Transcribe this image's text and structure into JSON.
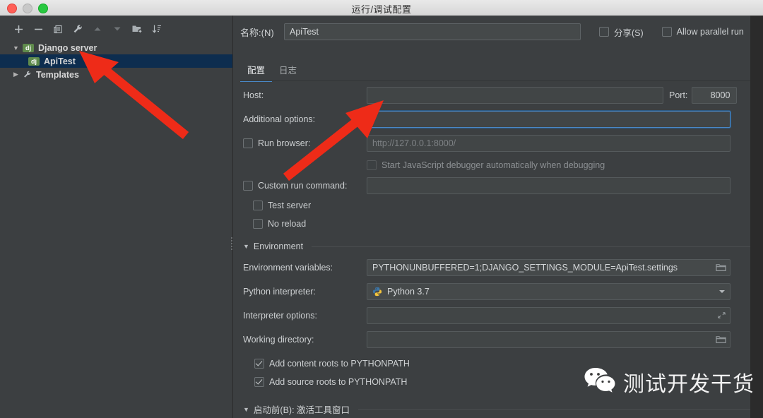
{
  "window": {
    "title": "运行/调试配置",
    "traffic_lights": [
      "close-red",
      "minimize-gray",
      "zoom-green"
    ]
  },
  "sidebar": {
    "toolbar": [
      {
        "name": "add-button",
        "glyph": "+"
      },
      {
        "name": "remove-button",
        "glyph": "−"
      },
      {
        "name": "copy-configuration-button",
        "glyph": "copy-icon"
      },
      {
        "name": "edit-templates-button",
        "glyph": "wrench-icon"
      },
      {
        "name": "move-up-button",
        "glyph": "triangle-up-icon"
      },
      {
        "name": "move-down-button",
        "glyph": "triangle-down-icon"
      },
      {
        "name": "new-folder-button",
        "glyph": "folder-plus-icon"
      },
      {
        "name": "sort-configurations-button",
        "glyph": "sort-icon"
      }
    ],
    "tree": [
      {
        "label": "Django server",
        "badge": "dj",
        "expanded": true,
        "type": "group",
        "selected": false
      },
      {
        "label": "ApiTest",
        "badge": "dj",
        "type": "item",
        "selected": true
      },
      {
        "label": "Templates",
        "badge": "",
        "expanded": false,
        "type": "templates",
        "selected": false
      }
    ]
  },
  "main": {
    "name_label": "名称:(N)",
    "name_value": "ApiTest",
    "share_checkbox": {
      "label": "分享(S)",
      "checked": false
    },
    "parallel_checkbox": {
      "label": "Allow parallel run",
      "checked": false
    },
    "tabs": [
      {
        "label": "配置",
        "active": true
      },
      {
        "label": "日志",
        "active": false
      }
    ],
    "fields": {
      "host": {
        "label": "Host:",
        "value": "",
        "placeholder": ""
      },
      "port": {
        "label": "Port:",
        "value": "8000"
      },
      "additional_options": {
        "label": "Additional options:",
        "value": "",
        "focused": true
      },
      "run_browser": {
        "label": "Run browser:",
        "checked": false,
        "value": "",
        "placeholder": "http://127.0.0.1:8000/"
      },
      "start_js_debugger": {
        "label": "Start JavaScript debugger automatically when debugging",
        "checked": false,
        "disabled": true
      },
      "custom_run_command": {
        "label": "Custom run command:",
        "checked": false,
        "value": ""
      },
      "test_server": {
        "label": "Test server",
        "checked": false
      },
      "no_reload": {
        "label": "No reload",
        "checked": false
      }
    },
    "environment": {
      "section_title": "Environment",
      "env_vars": {
        "label": "Environment variables:",
        "value": "PYTHONUNBUFFERED=1;DJANGO_SETTINGS_MODULE=ApiTest.settings",
        "icon": "browse-folder-icon"
      },
      "python_interpreter": {
        "label": "Python interpreter:",
        "value": "Python 3.7",
        "icon": "python-icon"
      },
      "interpreter_options": {
        "label": "Interpreter options:",
        "value": "",
        "icon": "expand-icon"
      },
      "working_directory": {
        "label": "Working directory:",
        "value": "",
        "icon": "browse-folder-icon"
      },
      "add_content_roots": {
        "label": "Add content roots to PYTHONPATH",
        "checked": true
      },
      "add_source_roots": {
        "label": "Add source roots to PYTHONPATH",
        "checked": true
      }
    },
    "before_launch": {
      "label": "启动前(B): 激活工具窗口",
      "expanded": true
    }
  },
  "watermark": {
    "text": "测试开发干货",
    "icon": "wechat-icon"
  },
  "annotations": {
    "arrow_color": "#ee2b18",
    "arrows": [
      {
        "name": "arrow-to-apitest-tree-item",
        "points_to": "ApiTest"
      },
      {
        "name": "arrow-to-additional-options-field",
        "points_to": "Additional options"
      }
    ]
  },
  "colors": {
    "accent": "#4a88c7",
    "selection": "#0d2d4f",
    "panel_bg": "#3c3f41",
    "field_bg": "#45494a",
    "badge_green": "#5f8b4c"
  }
}
